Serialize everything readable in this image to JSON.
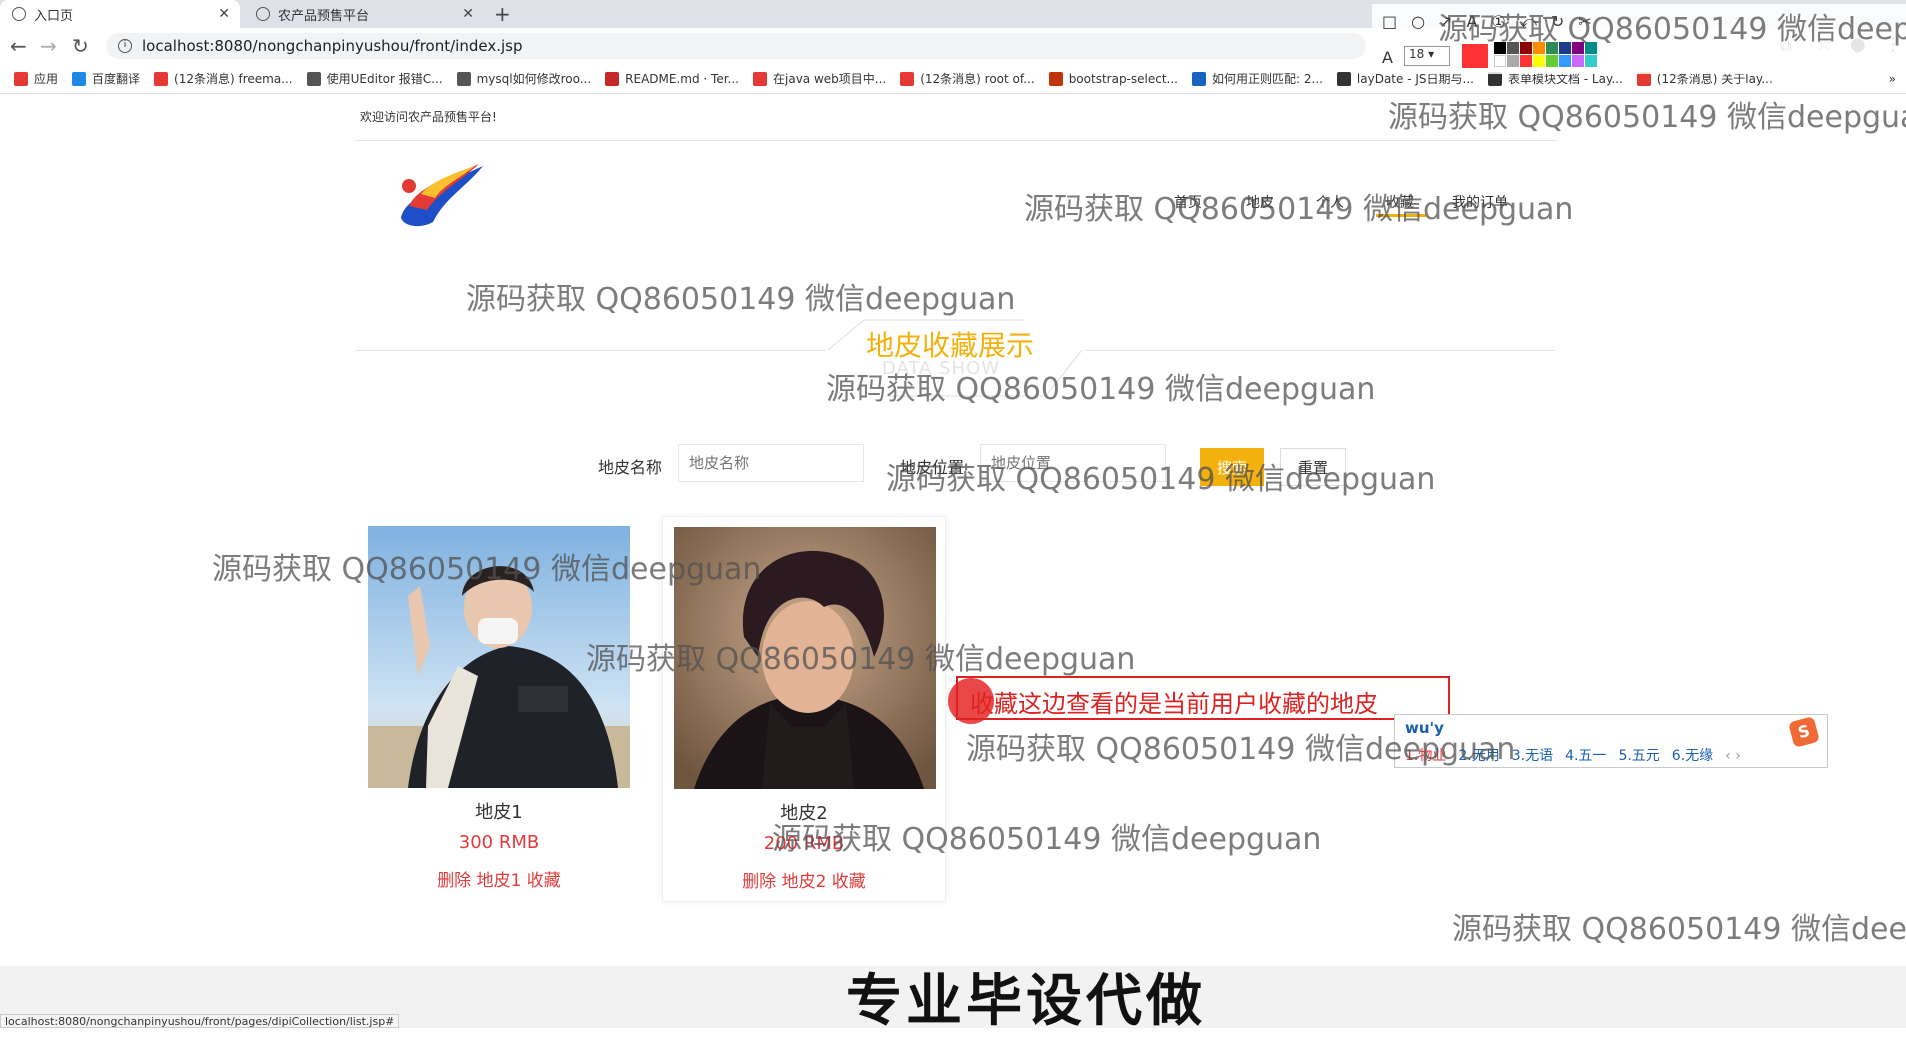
{
  "browser": {
    "tabs": [
      {
        "label": "入口页",
        "active": true
      },
      {
        "label": "农产品预售平台",
        "active": false
      }
    ],
    "new_tab": "+",
    "url": "localhost:8080/nongchanpinyushou/front/index.jsp",
    "bookmarks": [
      {
        "label": "应用",
        "color": "#e53935"
      },
      {
        "label": "百度翻译",
        "color": "#1e88e5"
      },
      {
        "label": "(12条消息) freema...",
        "color": "#e53935"
      },
      {
        "label": "使用UEditor 报错C...",
        "color": "#555555"
      },
      {
        "label": "mysql如何修改roo...",
        "color": "#555555"
      },
      {
        "label": "README.md · Ter...",
        "color": "#c62828"
      },
      {
        "label": "在java web项目中...",
        "color": "#e53935"
      },
      {
        "label": "(12条消息) root of...",
        "color": "#e53935"
      },
      {
        "label": "bootstrap-select...",
        "color": "#bf360c"
      },
      {
        "label": "如何用正则匹配: 2...",
        "color": "#1565c0"
      },
      {
        "label": "layDate - JS日期与...",
        "color": "#333333"
      },
      {
        "label": "表单模块文档 - Lay...",
        "color": "#333333"
      },
      {
        "label": "(12条消息) 关于lay...",
        "color": "#e53935"
      }
    ],
    "bookmarks_more": "»",
    "annot_font_size": "18",
    "status_url": "localhost:8080/nongchanpinyushou/front/pages/dipiCollection/list.jsp#"
  },
  "page": {
    "welcome": "欢迎访问农产品预售平台!",
    "nav": [
      "首页",
      "地皮",
      "个人",
      "收藏",
      "我的订单"
    ],
    "section_title": "地皮收藏展示",
    "section_subtitle": "DATA SHOW",
    "search": {
      "name_label": "地皮名称",
      "name_placeholder": "地皮名称",
      "position_label": "地皮位置",
      "position_placeholder": "地皮位置",
      "search_button": "搜索",
      "reset_button": "重置"
    },
    "cards": [
      {
        "name": "地皮1",
        "price": "300 RMB",
        "action": "删除 地皮1 收藏"
      },
      {
        "name": "地皮2",
        "price": "200 RMB",
        "action": "删除 地皮2 收藏"
      }
    ]
  },
  "annotation": {
    "note": "收藏这边查看的是当前用户收藏的地皮",
    "ime_input": "wu'y",
    "ime_candidates": [
      "1.物业",
      "2.无用",
      "3.无语",
      "4.五一",
      "5.五元",
      "6.无缘"
    ],
    "ime_nav": "‹ ›",
    "ime_logo": "S"
  },
  "watermark": "源码获取 QQ86050149 微信deepguan",
  "footer_banner": "专业毕设代做",
  "colors": {
    "accent": "#f3b10f",
    "price_red": "#e23b3b",
    "note_red": "#d22222"
  }
}
